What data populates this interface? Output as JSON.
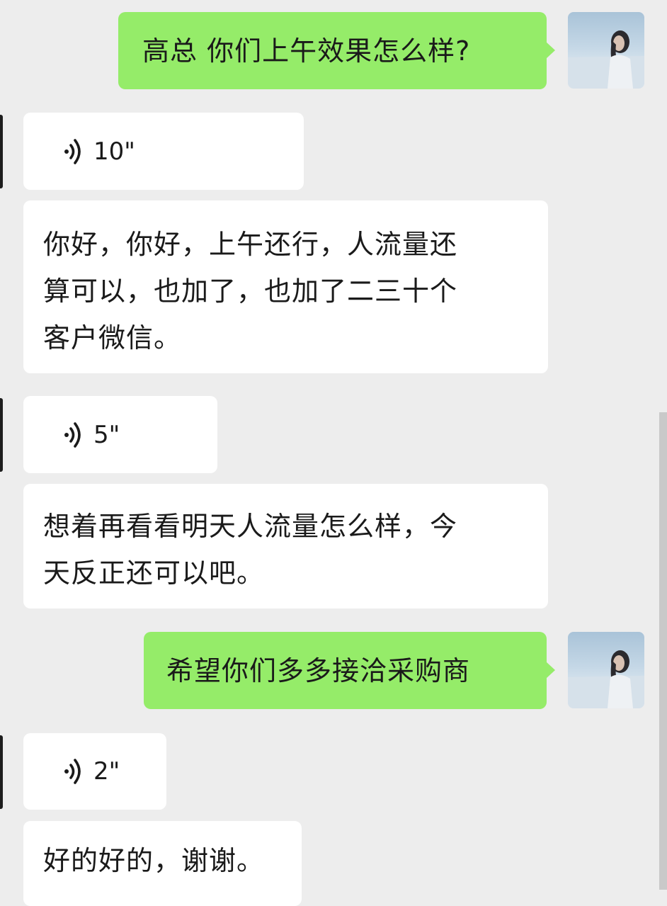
{
  "colors": {
    "background": "#ededed",
    "sent_bubble": "#95ec69",
    "received_bubble": "#ffffff"
  },
  "messages": [
    {
      "side": "sent",
      "type": "text",
      "text": "高总 你们上午效果怎么样?"
    },
    {
      "side": "received",
      "type": "voice",
      "duration": "10\""
    },
    {
      "side": "received",
      "type": "text",
      "lines": [
        "你好，你好，上午还行，人流量还",
        "算可以，也加了，也加了二三十个",
        "客户微信。"
      ]
    },
    {
      "side": "received",
      "type": "voice",
      "duration": "5\""
    },
    {
      "side": "received",
      "type": "text",
      "lines": [
        "想着再看看明天人流量怎么样，今",
        "天反正还可以吧。"
      ]
    },
    {
      "side": "sent",
      "type": "text",
      "text": "希望你们多多接洽采购商"
    },
    {
      "side": "received",
      "type": "voice",
      "duration": "2\""
    },
    {
      "side": "received",
      "type": "text",
      "text": "好的好的，谢谢。"
    }
  ],
  "icons": {
    "voice": "voice-wave-icon",
    "avatar": "user-avatar"
  }
}
